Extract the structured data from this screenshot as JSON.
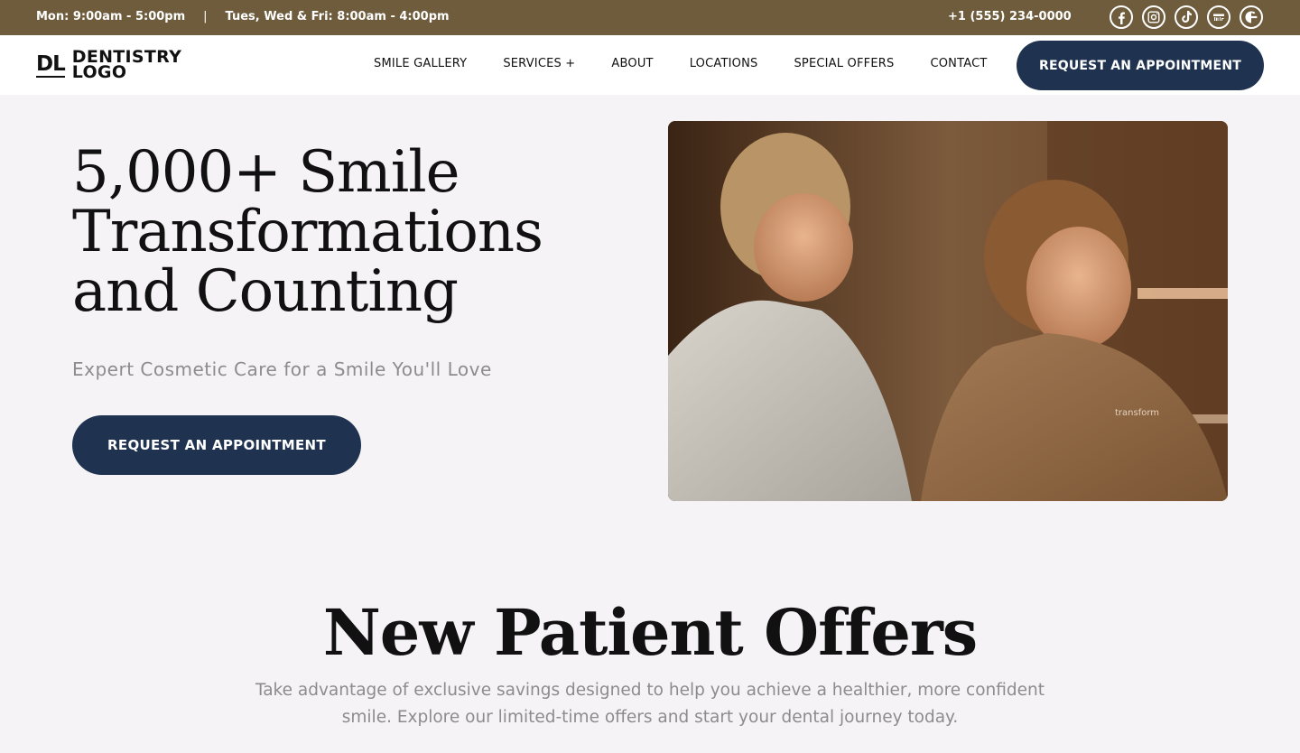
{
  "topbar": {
    "hours_1": "Mon: 9:00am - 5:00pm",
    "separator": "|",
    "hours_2": "Tues, Wed & Fri: 8:00am - 4:00pm",
    "phone": "+1 (555) 234-0000",
    "social_icons": [
      "facebook-icon",
      "instagram-icon",
      "tiktok-icon",
      "youtube-icon",
      "google-icon"
    ],
    "background": "#6e5c3d"
  },
  "header": {
    "logo_mark": "DL",
    "logo_line_1": "DENTISTRY",
    "logo_line_2": "LOGO",
    "nav": [
      {
        "label": "SMILE GALLERY"
      },
      {
        "label": "SERVICES +"
      },
      {
        "label": "ABOUT"
      },
      {
        "label": "LOCATIONS"
      },
      {
        "label": "SPECIAL OFFERS"
      },
      {
        "label": "CONTACT"
      }
    ],
    "cta_label": "REQUEST AN APPOINTMENT",
    "cta_color": "#1f3250"
  },
  "hero": {
    "title_line_1": "5,000+ Smile",
    "title_line_2": "Transformations",
    "title_line_3": "and Counting",
    "subtitle": "Expert Cosmetic Care for a Smile You'll Love",
    "cta_label": "REQUEST AN APPOINTMENT",
    "robe_text": "transform"
  },
  "offers": {
    "title": "New Patient Offers",
    "text": "Take advantage of exclusive savings designed to help you achieve a healthier, more confident smile. Explore our limited-time offers and start your dental journey today."
  }
}
